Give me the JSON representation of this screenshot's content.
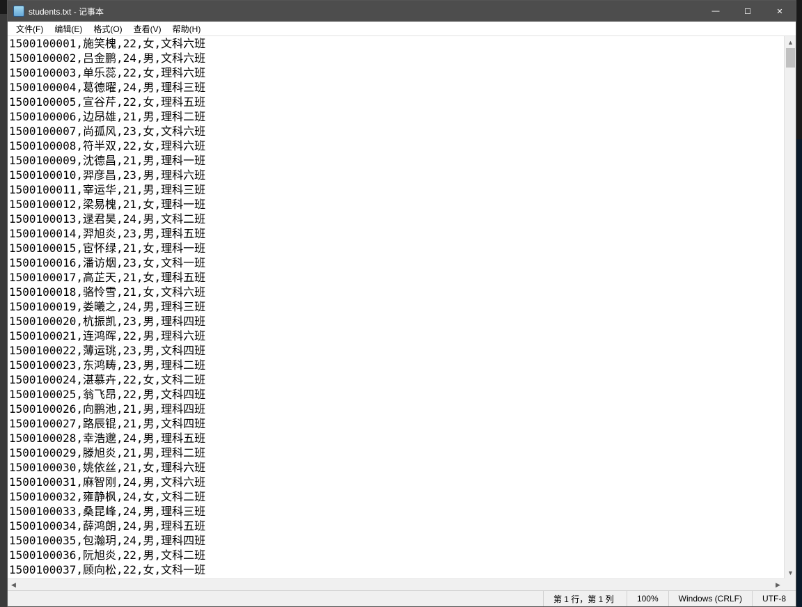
{
  "window": {
    "title": "students.txt - 记事本",
    "controls": {
      "minimize": "—",
      "maximize": "☐",
      "close": "✕"
    }
  },
  "menu": {
    "file": "文件(F)",
    "edit": "编辑(E)",
    "format": "格式(O)",
    "view": "查看(V)",
    "help": "帮助(H)"
  },
  "lines": [
    "1500100001,施笑槐,22,女,文科六班",
    "1500100002,吕金鹏,24,男,文科六班",
    "1500100003,单乐蕊,22,女,理科六班",
    "1500100004,葛德曜,24,男,理科三班",
    "1500100005,宣谷芹,22,女,理科五班",
    "1500100006,边昂雄,21,男,理科二班",
    "1500100007,尚孤风,23,女,文科六班",
    "1500100008,符半双,22,女,理科六班",
    "1500100009,沈德昌,21,男,理科一班",
    "1500100010,羿彦昌,23,男,理科六班",
    "1500100011,宰运华,21,男,理科三班",
    "1500100012,梁易槐,21,女,理科一班",
    "1500100013,逯君昊,24,男,文科二班",
    "1500100014,羿旭炎,23,男,理科五班",
    "1500100015,宦怀绿,21,女,理科一班",
    "1500100016,潘访烟,23,女,文科一班",
    "1500100017,高芷天,21,女,理科五班",
    "1500100018,骆怜雪,21,女,文科六班",
    "1500100019,娄曦之,24,男,理科三班",
    "1500100020,杭振凯,23,男,理科四班",
    "1500100021,连鸿晖,22,男,理科六班",
    "1500100022,薄运珧,23,男,文科四班",
    "1500100023,东鸿畴,23,男,理科二班",
    "1500100024,湛慕卉,22,女,文科二班",
    "1500100025,翁飞昂,22,男,文科四班",
    "1500100026,向鹏池,21,男,理科四班",
    "1500100027,路辰锟,21,男,文科四班",
    "1500100028,幸浩邈,24,男,理科五班",
    "1500100029,滕旭炎,21,男,理科二班",
    "1500100030,姚依丝,21,女,理科六班",
    "1500100031,麻智刚,24,男,文科六班",
    "1500100032,雍静枫,24,女,文科二班",
    "1500100033,桑昆峰,24,男,理科三班",
    "1500100034,薛鸿朗,24,男,理科五班",
    "1500100035,包瀚玥,24,男,理科四班",
    "1500100036,阮旭炎,22,男,文科二班",
    "1500100037,顾向松,22,女,文科一班"
  ],
  "status": {
    "position": "第 1 行，第 1 列",
    "zoom": "100%",
    "eol": "Windows (CRLF)",
    "encoding": "UTF-8"
  }
}
